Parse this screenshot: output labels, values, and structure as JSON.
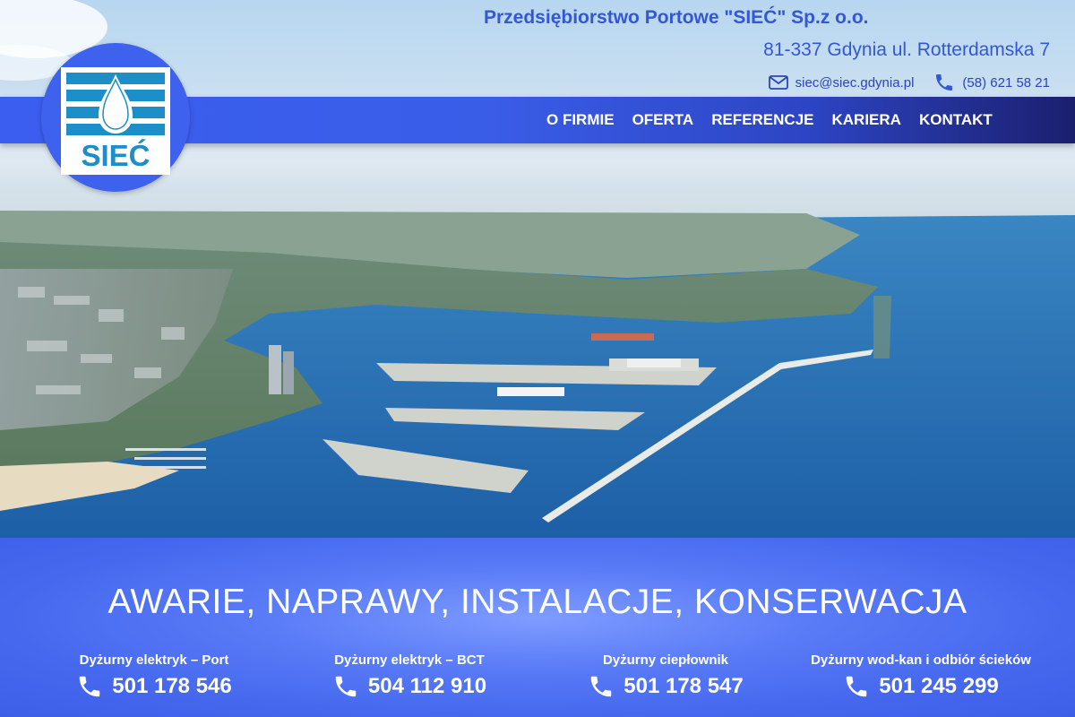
{
  "header": {
    "company_name": "Przedsiębiorstwo Portowe \"SIEĆ\" Sp.z o.o.",
    "address": "81-337 Gdynia ul. Rotterdamska 7",
    "email": "siec@siec.gdynia.pl",
    "phone": "(58) 621 58 21"
  },
  "logo": {
    "text": "SIEĆ",
    "color": "#3e62ee"
  },
  "nav": {
    "items": [
      {
        "label": "O FIRMIE"
      },
      {
        "label": "OFERTA"
      },
      {
        "label": "REFERENCJE"
      },
      {
        "label": "KARIERA"
      },
      {
        "label": "KONTAKT"
      }
    ]
  },
  "hero": {
    "description_icon": "aerial-photo"
  },
  "bottom": {
    "tagline": "AWARIE, NAPRAWY, INSTALACJE, KONSERWACJA",
    "services": [
      {
        "label": "Dyżurny elektryk – Port",
        "phone": "501 178 546"
      },
      {
        "label": "Dyżurny elektryk – BCT",
        "phone": "504 112 910"
      },
      {
        "label": "Dyżurny ciepłownik",
        "phone": "501 178 547"
      },
      {
        "label": "Dyżurny wod-kan i odbiór ścieków",
        "phone": "501 245 299"
      }
    ]
  },
  "colors": {
    "accent": "#3457d5",
    "nav_start": "#3b5ef0",
    "nav_end": "#1b1f6e",
    "white": "#ffffff"
  }
}
